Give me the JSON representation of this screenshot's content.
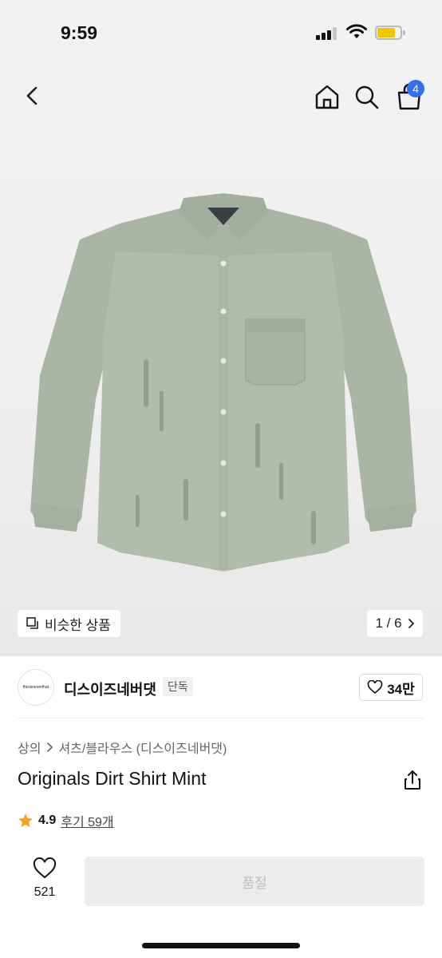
{
  "status_bar": {
    "time": "9:59"
  },
  "nav": {
    "cart_count": "4",
    "icons": [
      "back-chevron-icon",
      "home-icon",
      "search-icon",
      "cart-icon"
    ]
  },
  "hero": {
    "similar_label": "비슷한 상품",
    "pager": "1 / 6",
    "colors": {
      "shirt": "#aebba9",
      "background": "#efefef"
    }
  },
  "brand": {
    "logo_text": "thisisneverthat",
    "name": "디스이즈네버댓",
    "tag": "단독",
    "likes": "34만"
  },
  "breadcrumb": [
    "상의",
    "셔츠/블라우스 (디스이즈네버댓)"
  ],
  "product": {
    "title": "Originals Dirt Shirt Mint",
    "rating": "4.9",
    "reviews": "후기 59개"
  },
  "bottom_bar": {
    "like_count": "521",
    "soldout_label": "품절"
  }
}
